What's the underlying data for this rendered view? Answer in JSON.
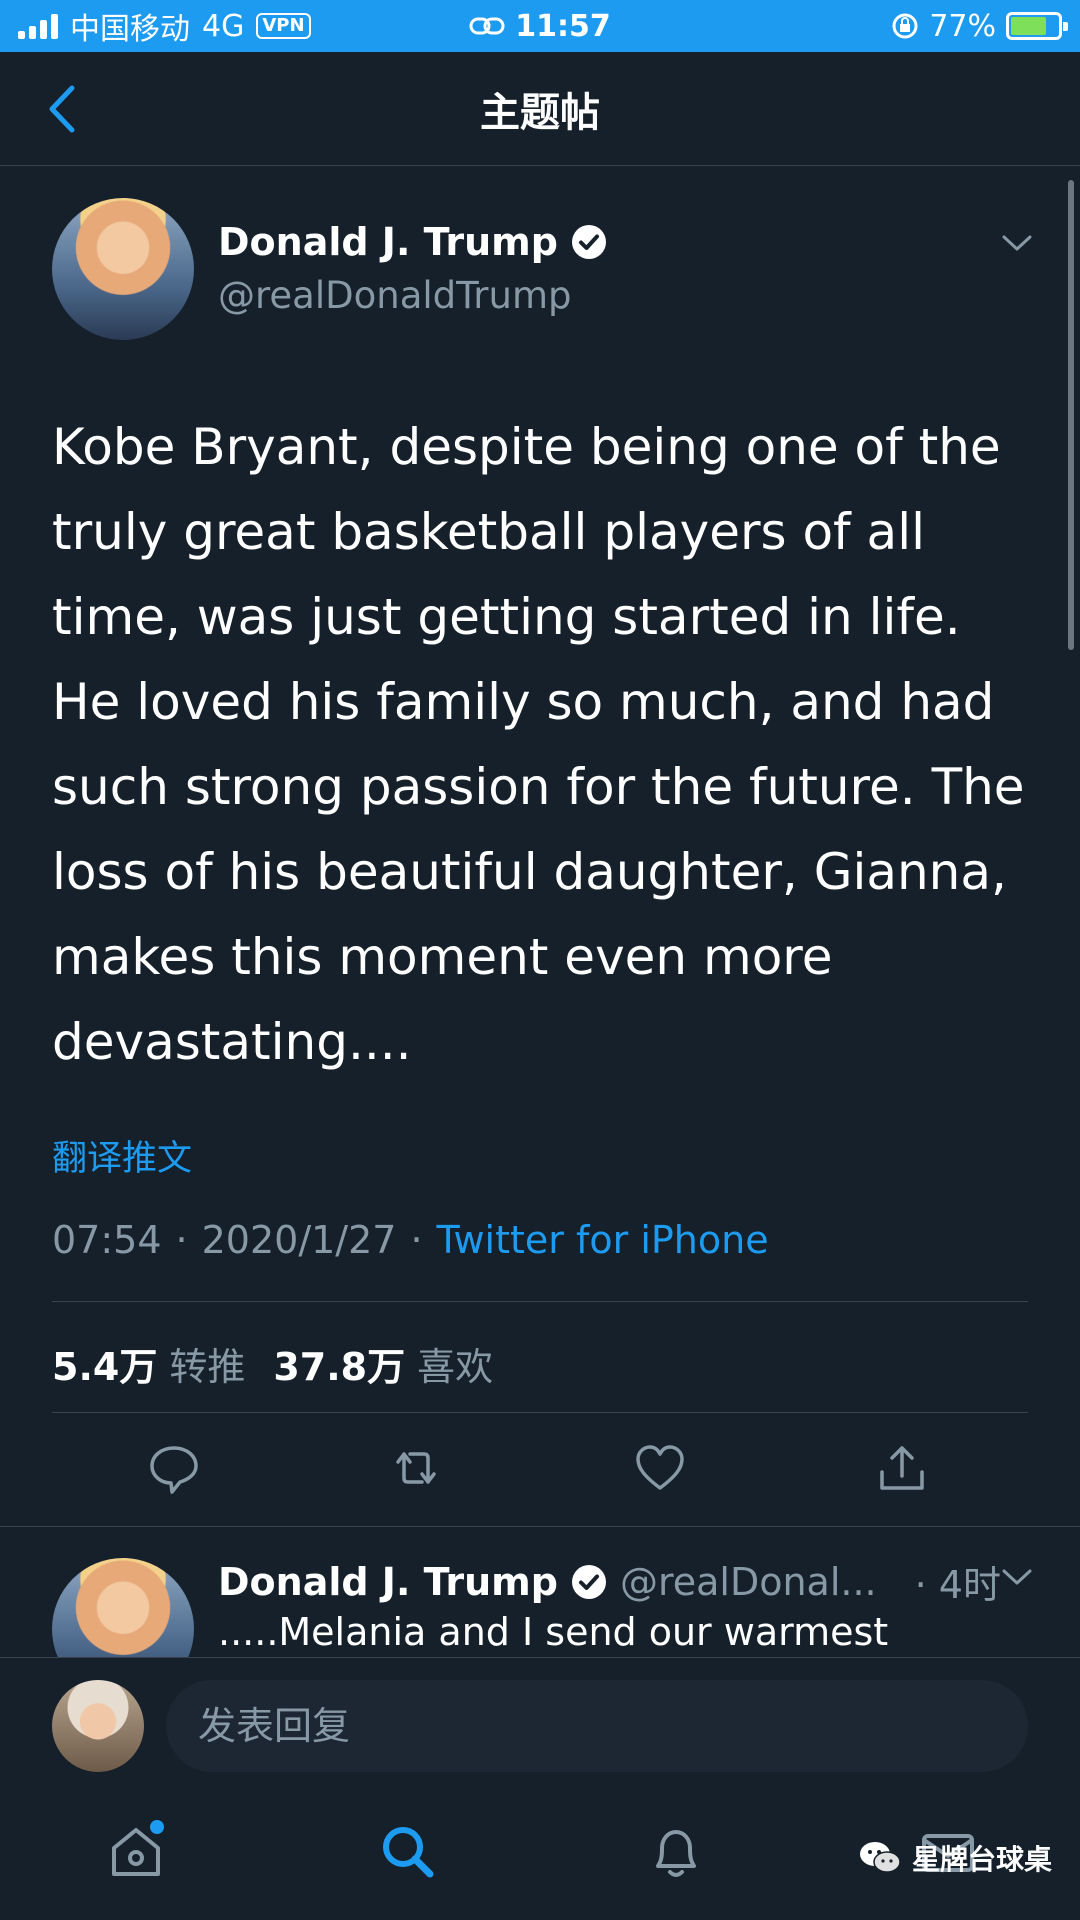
{
  "status_bar": {
    "carrier": "中国移动",
    "network": "4G",
    "vpn": "VPN",
    "time": "11:57",
    "battery": "77%",
    "battery_level": 0.77
  },
  "header": {
    "title": "主题帖"
  },
  "tweet": {
    "author_name": "Donald J. Trump",
    "author_handle": "@realDonaldTrump",
    "text": "Kobe Bryant, despite being one of the truly great basketball players of all time, was just getting started in life. He loved his family so much, and had such strong passion for the future. The loss of his beautiful daughter, Gianna, makes this moment even more devastating....",
    "translate_label": "翻译推文",
    "time": "07:54",
    "date": "2020/1/27",
    "dot": "·",
    "source": "Twitter for iPhone",
    "retweets": "5.4万",
    "retweets_label": "转推",
    "likes": "37.8万",
    "likes_label": "喜欢"
  },
  "reply_preview": {
    "author_name": "Donald J. Trump",
    "author_handle": "@realDonal...",
    "time": "· 4时",
    "text": ".....Melania and I send our warmest"
  },
  "compose": {
    "placeholder": "发表回复"
  },
  "watermark": {
    "text": "星牌台球桌"
  },
  "colors": {
    "accent": "#1d9bf0",
    "background": "#15202b",
    "muted": "#8899a6",
    "divider": "#38444d"
  }
}
